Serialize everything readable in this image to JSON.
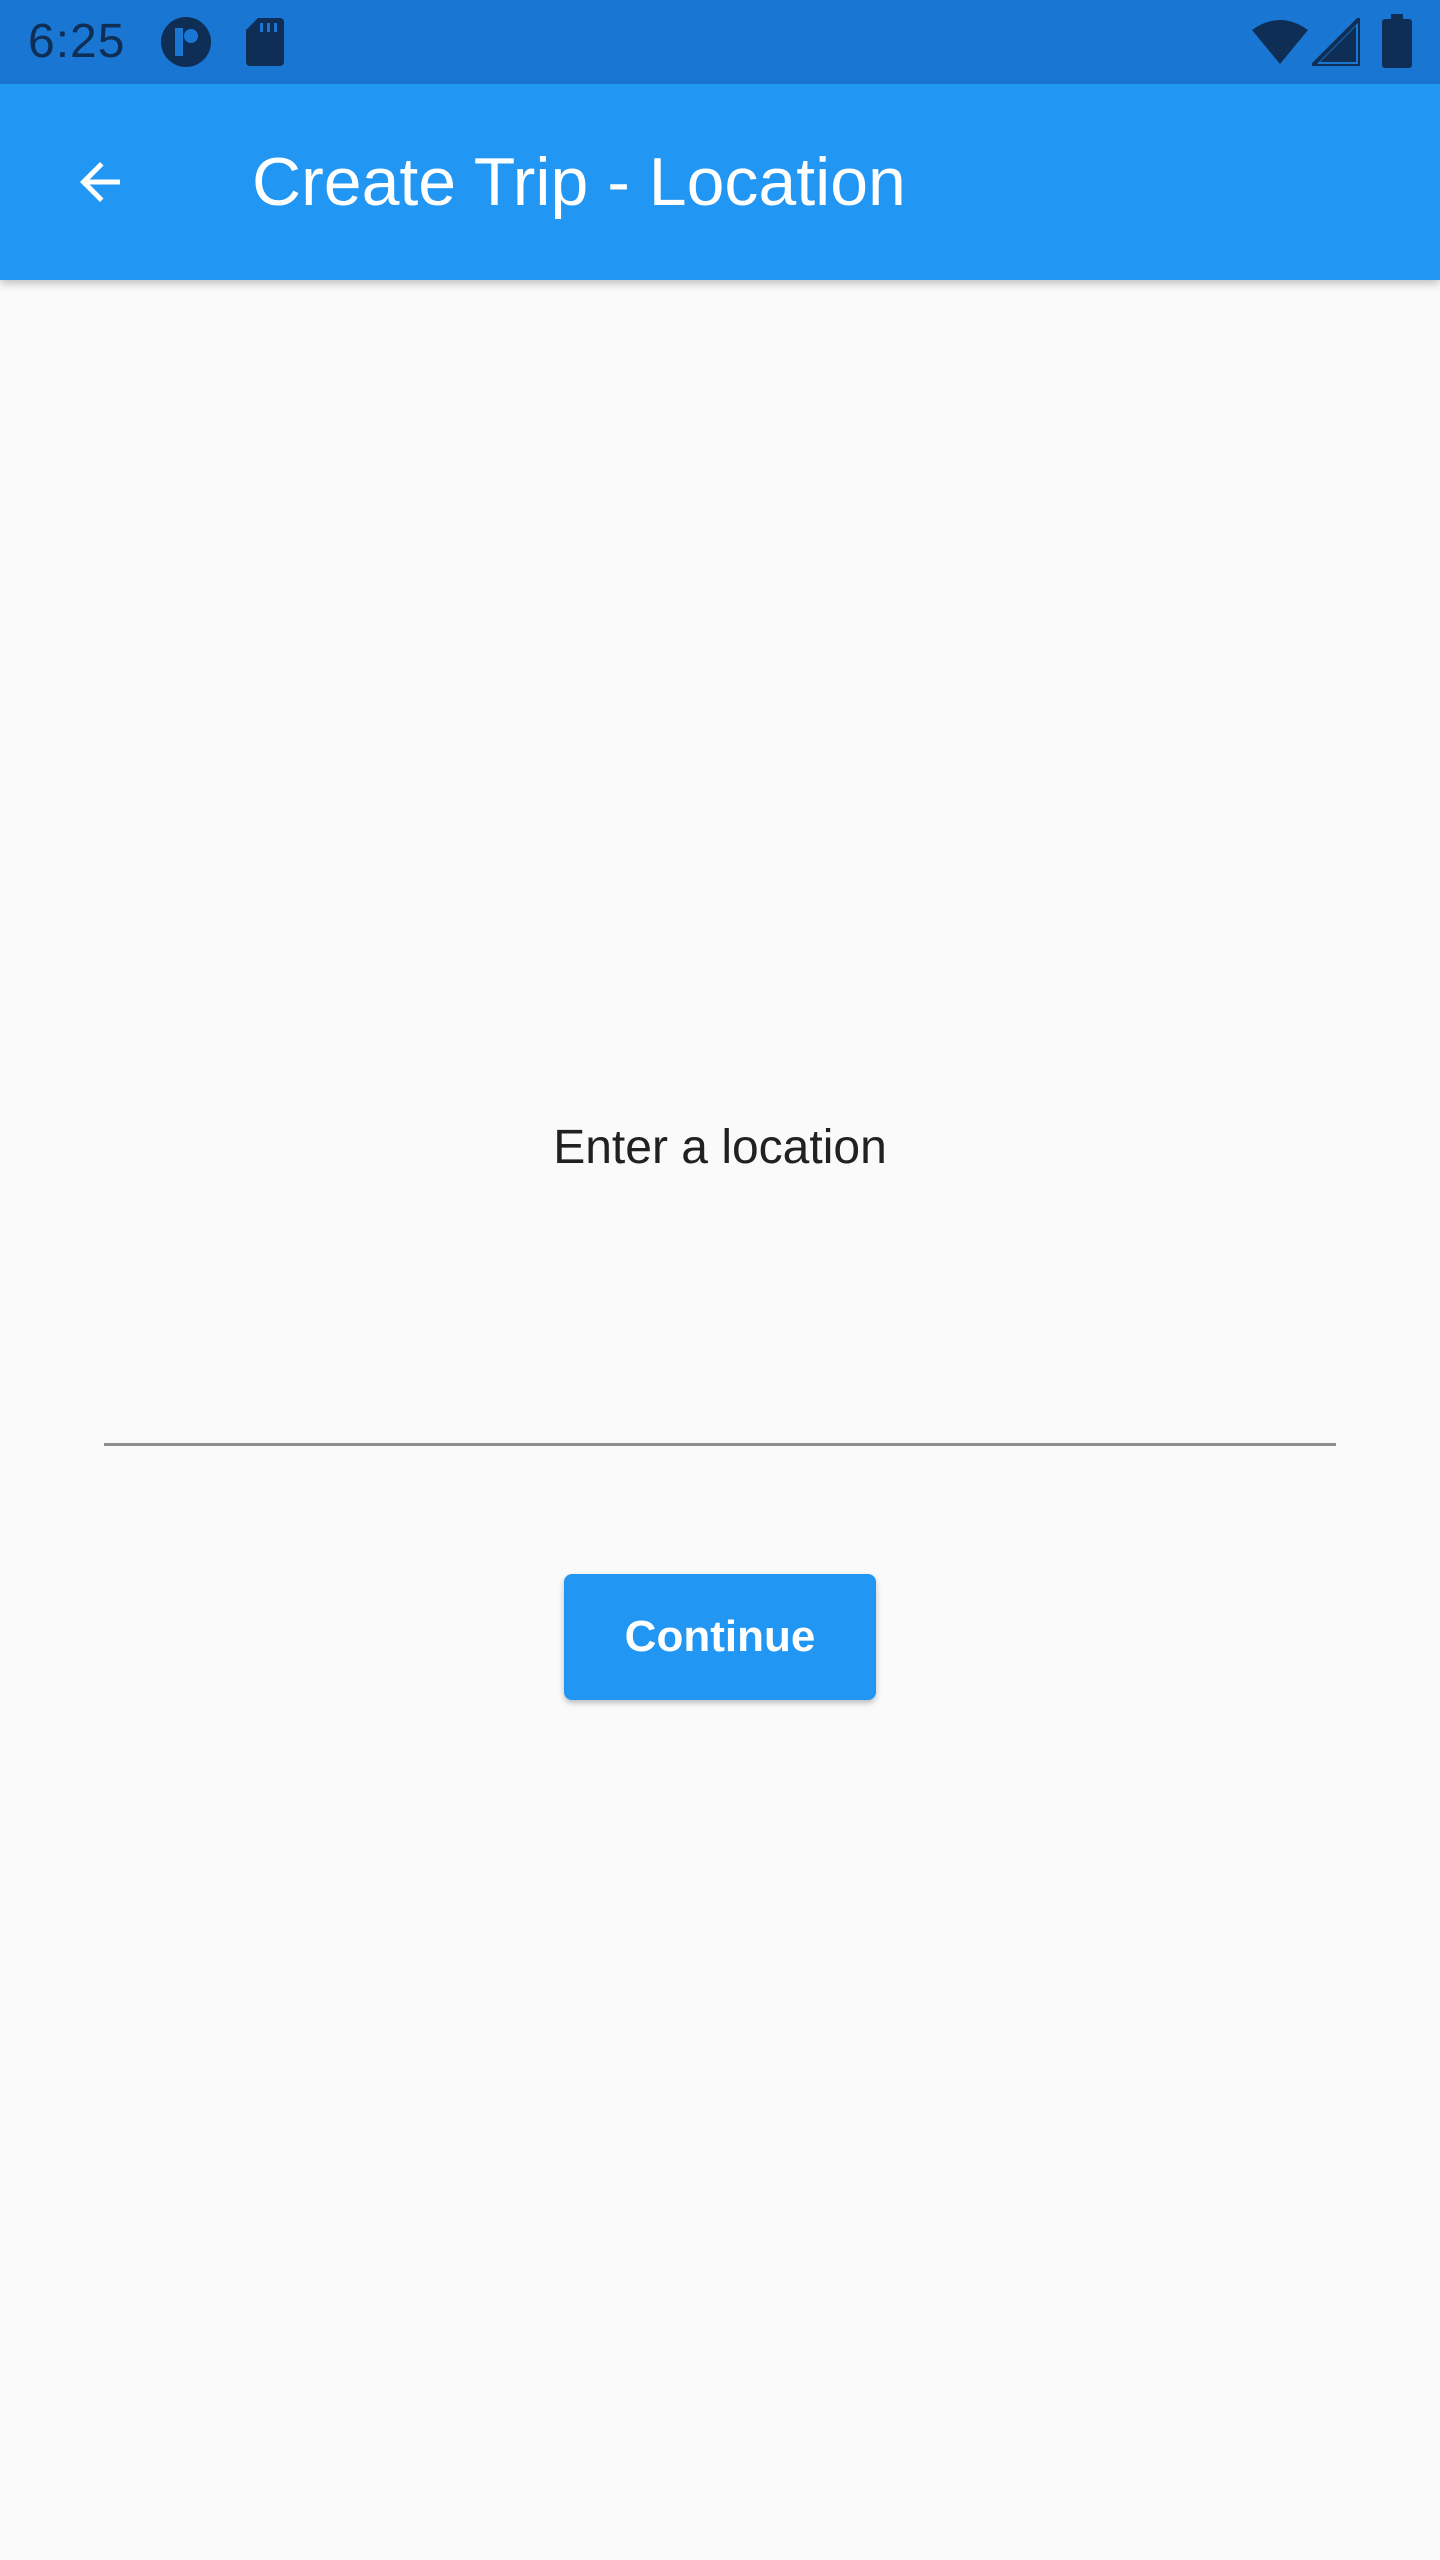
{
  "status_bar": {
    "time": "6:25",
    "left_icons": [
      "notification-app-icon",
      "sd-card-icon"
    ],
    "right_icons": [
      "wifi-icon",
      "cellular-signal-icon",
      "battery-icon"
    ],
    "background_color": "#1976D2"
  },
  "app_bar": {
    "title": "Create Trip - Location",
    "back_icon": "arrow-back-icon",
    "background_color": "#2196F3"
  },
  "main": {
    "prompt_label": "Enter a location",
    "location_input": {
      "value": "",
      "placeholder": ""
    },
    "continue_label": "Continue"
  },
  "colors": {
    "accent": "#2196F3",
    "background": "#FAFAFA"
  }
}
